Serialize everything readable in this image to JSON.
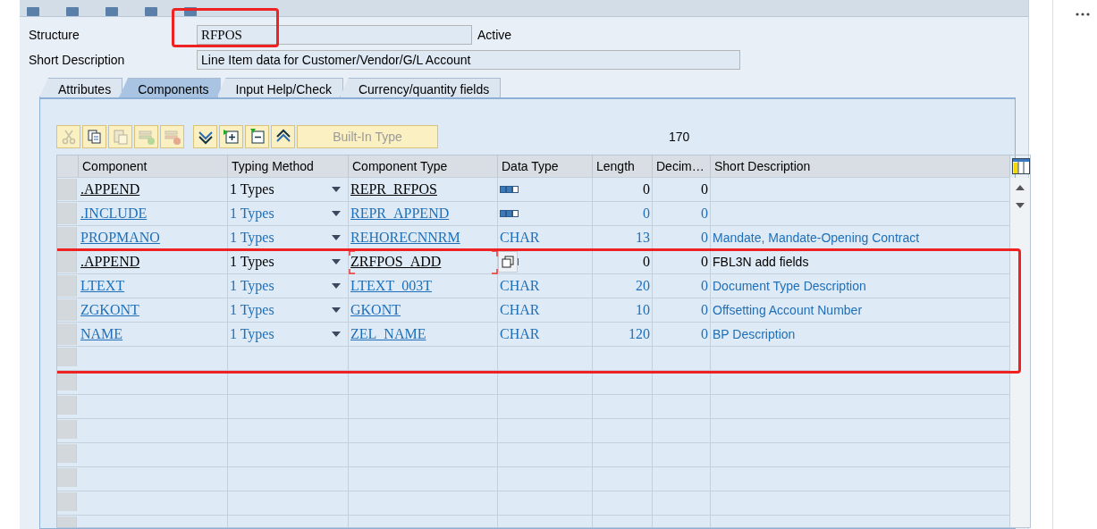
{
  "structure": {
    "label": "Structure",
    "value": "RFPOS",
    "status": "Active",
    "highlighted": true
  },
  "short_description": {
    "label": "Short Description",
    "value": "Line Item data for Customer/Vendor/G/L Account"
  },
  "tabs": [
    {
      "label": "Attributes",
      "selected": false
    },
    {
      "label": "Components",
      "selected": true
    },
    {
      "label": "Input Help/Check",
      "selected": false
    },
    {
      "label": "Currency/quantity fields",
      "selected": false
    }
  ],
  "toolbar": {
    "built_in_type": "Built-In Type",
    "count": "170"
  },
  "table": {
    "columns": [
      "Component",
      "Typing Method",
      "Component Type",
      "Data Type",
      "Length",
      "Decim…",
      "Short Description"
    ],
    "rows": [
      {
        "kind": "append",
        "component": ".APPEND",
        "typing_method": "1 Types",
        "component_type": "REPR_RFPOS",
        "length": "0",
        "decimals": "0",
        "focused": false,
        "highlighted": false
      },
      {
        "kind": "include",
        "component": ".INCLUDE",
        "typing_method": "1 Types",
        "component_type": "REPR_APPEND",
        "length": "0",
        "decimals": "0",
        "focused": false,
        "highlighted": false
      },
      {
        "kind": "field",
        "component": "PROPMANO",
        "typing_method": "1 Types",
        "component_type": "REHORECNNRM",
        "data_type": "CHAR",
        "length": "13",
        "decimals": "0",
        "short_description": "Mandate, Mandate-Opening Contract",
        "focused": false,
        "highlighted": false
      },
      {
        "kind": "append",
        "component": ".APPEND",
        "typing_method": "1 Types",
        "component_type": "ZRFPOS_ADD",
        "length": "0",
        "decimals": "0",
        "short_description": "FBL3N add fields",
        "focused": true,
        "highlighted": true
      },
      {
        "kind": "field",
        "component": "LTEXT",
        "typing_method": "1 Types",
        "component_type": "LTEXT_003T",
        "data_type": "CHAR",
        "length": "20",
        "decimals": "0",
        "short_description": "Document Type Description",
        "focused": false,
        "highlighted": true
      },
      {
        "kind": "field",
        "component": "ZGKONT",
        "typing_method": "1 Types",
        "component_type": "GKONT",
        "data_type": "CHAR",
        "length": "10",
        "decimals": "0",
        "short_description": "Offsetting Account Number",
        "focused": false,
        "highlighted": true
      },
      {
        "kind": "field",
        "component": "NAME",
        "typing_method": "1 Types",
        "component_type": "ZEL_NAME",
        "data_type": "CHAR",
        "length": "120",
        "decimals": "0",
        "short_description": "BP Description",
        "focused": false,
        "highlighted": true
      }
    ]
  }
}
